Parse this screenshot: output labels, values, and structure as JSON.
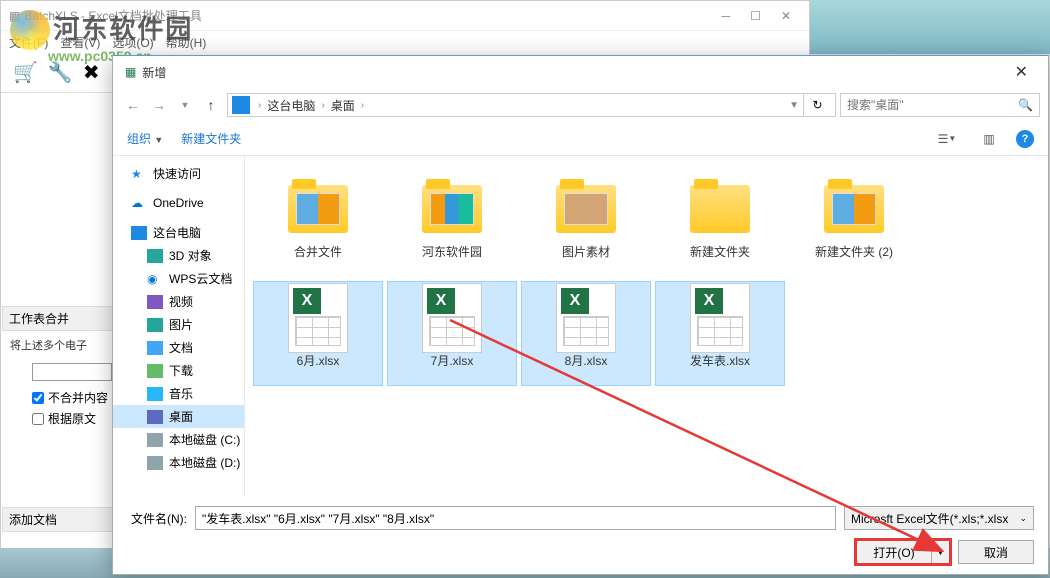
{
  "bgApp": {
    "title": "BatchXLS - Excel文档批处理工具",
    "menu": [
      "文件(F)",
      "查看(V)",
      "选项(O)",
      "帮助(H)"
    ],
    "section1": "工作表合并",
    "sub1": "将上述多个电子",
    "check1": "不合并内容",
    "check2": "根据原文",
    "section2": "添加文档"
  },
  "watermark": {
    "text": "河东软件园",
    "url": "www.pc0359.cn"
  },
  "dialog": {
    "title": "新增",
    "breadcrumb": [
      "这台电脑",
      "桌面"
    ],
    "searchPlaceholder": "搜索\"桌面\"",
    "organize": "组织",
    "newFolder": "新建文件夹",
    "tree": {
      "quick": "快速访问",
      "onedrive": "OneDrive",
      "pc": "这台电脑",
      "obj3d": "3D 对象",
      "wps": "WPS云文档",
      "video": "视频",
      "pics": "图片",
      "docs": "文档",
      "downloads": "下载",
      "music": "音乐",
      "desktop": "桌面",
      "diskC": "本地磁盘 (C:)",
      "diskD": "本地磁盘 (D:)"
    },
    "files": [
      {
        "name": "合并文件",
        "type": "folder",
        "thumb": "fb1"
      },
      {
        "name": "河东软件园",
        "type": "folder",
        "thumb": "fb2"
      },
      {
        "name": "图片素材",
        "type": "folder",
        "thumb": "fb3"
      },
      {
        "name": "新建文件夹",
        "type": "folder",
        "thumb": ""
      },
      {
        "name": "新建文件夹 (2)",
        "type": "folder",
        "thumb": "fb1"
      },
      {
        "name": "6月.xlsx",
        "type": "excel",
        "selected": true
      },
      {
        "name": "7月.xlsx",
        "type": "excel",
        "selected": true
      },
      {
        "name": "8月.xlsx",
        "type": "excel",
        "selected": true
      },
      {
        "name": "发车表.xlsx",
        "type": "excel",
        "selected": true
      }
    ],
    "fileNameLabel": "文件名(N):",
    "fileNameValue": "\"发车表.xlsx\" \"6月.xlsx\" \"7月.xlsx\" \"8月.xlsx\"",
    "filter": "Microsft Excel文件(*.xls;*.xlsx",
    "openBtn": "打开(O)",
    "cancelBtn": "取消"
  }
}
